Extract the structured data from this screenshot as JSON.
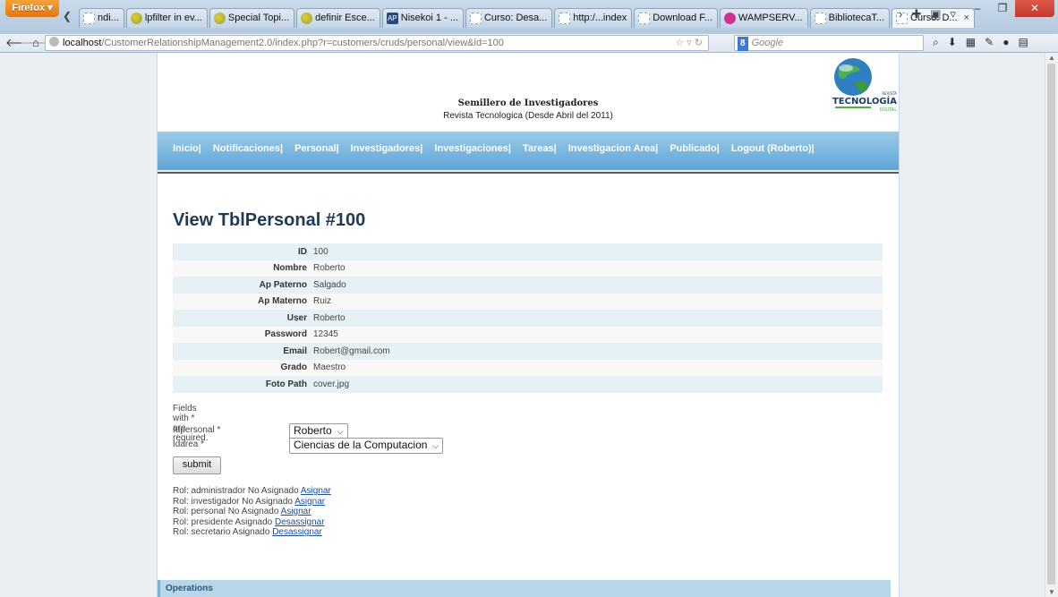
{
  "browser": {
    "app_button": "Firefox",
    "tabs": [
      {
        "label": "ndi...",
        "icon": "page"
      },
      {
        "label": "lpfilter in ev...",
        "icon": "leaf"
      },
      {
        "label": "Special Topi...",
        "icon": "leaf"
      },
      {
        "label": "definir Esce...",
        "icon": "leaf"
      },
      {
        "label": "Nisekoi 1 - ...",
        "icon": "ap"
      },
      {
        "label": "Curso: Desa...",
        "icon": "page"
      },
      {
        "label": "http:/...index",
        "icon": "page"
      },
      {
        "label": "Download F...",
        "icon": "page"
      },
      {
        "label": "WAMPSERV...",
        "icon": "wamp"
      },
      {
        "label": "BibliotecaT...",
        "icon": "page"
      },
      {
        "label": "Curso: D...",
        "icon": "page",
        "active": true
      }
    ],
    "url_host": "localhost",
    "url_path": "/CustomerRelationshipManagement2.0/index.php?r=customers/cruds/personal/view&id=100",
    "search_engine_badge": "8",
    "search_placeholder": "Google"
  },
  "site": {
    "title": "Semillero de Investigadores",
    "subtitle": "Revista Tecnologica (Desde Abril del 2011)",
    "logo_top": "REVISTA",
    "logo_main": "TECNOLOGÍA",
    "logo_sub": "DIGITAL"
  },
  "menu": [
    "Inicio|",
    "Notificaciones|",
    "Personal|",
    "Investigadores|",
    "Investigaciones|",
    "Tareas|",
    "Investigacion Area|",
    "Publicado|",
    "Logout (Roberto)|"
  ],
  "view": {
    "title": "View TblPersonal #100",
    "rows": [
      {
        "label": "ID",
        "value": "100"
      },
      {
        "label": "Nombre",
        "value": "Roberto"
      },
      {
        "label": "Ap Paterno",
        "value": "Salgado"
      },
      {
        "label": "Ap Materno",
        "value": "Ruiz"
      },
      {
        "label": "User",
        "value": "Roberto"
      },
      {
        "label": "Password",
        "value": "12345"
      },
      {
        "label": "Email",
        "value": "Robert@gmail.com"
      },
      {
        "label": "Grado",
        "value": "Maestro"
      },
      {
        "label": "Foto Path",
        "value": "cover.jpg"
      }
    ]
  },
  "form": {
    "note": "Fields with * are required.",
    "idpersonal_label": "Idpersonal *",
    "idpersonal_value": "Roberto",
    "idarea_label": "Idarea *",
    "idarea_value": "Ciencias de la Computacion",
    "submit_label": "submit"
  },
  "roles": [
    {
      "text": "Rol: administrador No Asignado",
      "action": "Asignar"
    },
    {
      "text": "Rol: investigador No Asignado",
      "action": "Asignar"
    },
    {
      "text": "Rol: personal No Asignado",
      "action": "Asignar"
    },
    {
      "text": "Rol: presidente Asignado",
      "action": "Desassignar"
    },
    {
      "text": "Rol: secretario Asignado",
      "action": "Desassignar"
    }
  ],
  "operations": {
    "title": "Operations"
  }
}
